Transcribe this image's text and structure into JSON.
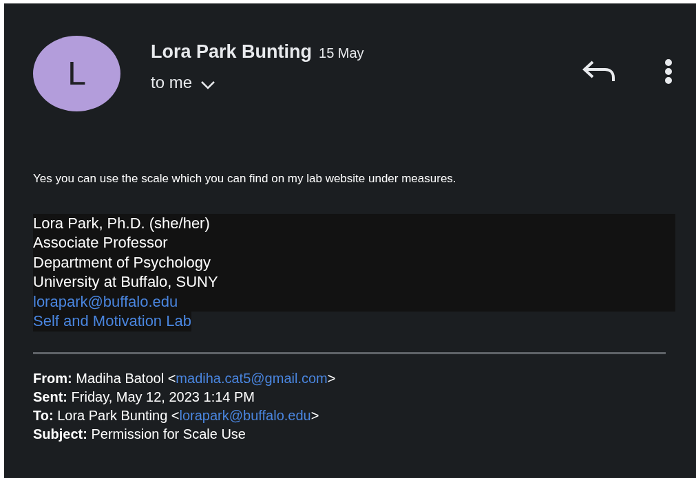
{
  "sender": {
    "initial": "L",
    "name": "Lora Park Bunting",
    "date": "15 May",
    "recipient": "to me"
  },
  "body": "Yes you can use the scale which you can find on my lab website under measures.",
  "signature": [
    {
      "kind": "text",
      "text": "Lora Park, Ph.D. (she/her)"
    },
    {
      "kind": "text",
      "text": "Associate Professor"
    },
    {
      "kind": "text",
      "text": "Department of Psychology"
    },
    {
      "kind": "text",
      "text": "University at Buffalo, SUNY"
    },
    {
      "kind": "link",
      "text": "lorapark@buffalo.edu"
    },
    {
      "kind": "link",
      "text": "Self and Motivation Lab"
    }
  ],
  "quoted_header": [
    {
      "label": "From:",
      "value": "Madiha Batool <",
      "link": "madiha.cat5@gmail.com",
      "after": ">"
    },
    {
      "label": "Sent:",
      "value": "Friday, May 12, 2023 1:14 PM"
    },
    {
      "label": "To:",
      "value": "Lora Park Bunting <",
      "link": "lorapark@buffalo.edu",
      "after": ">"
    },
    {
      "label": "Subject:",
      "value": "Permission for Scale Use"
    }
  ]
}
